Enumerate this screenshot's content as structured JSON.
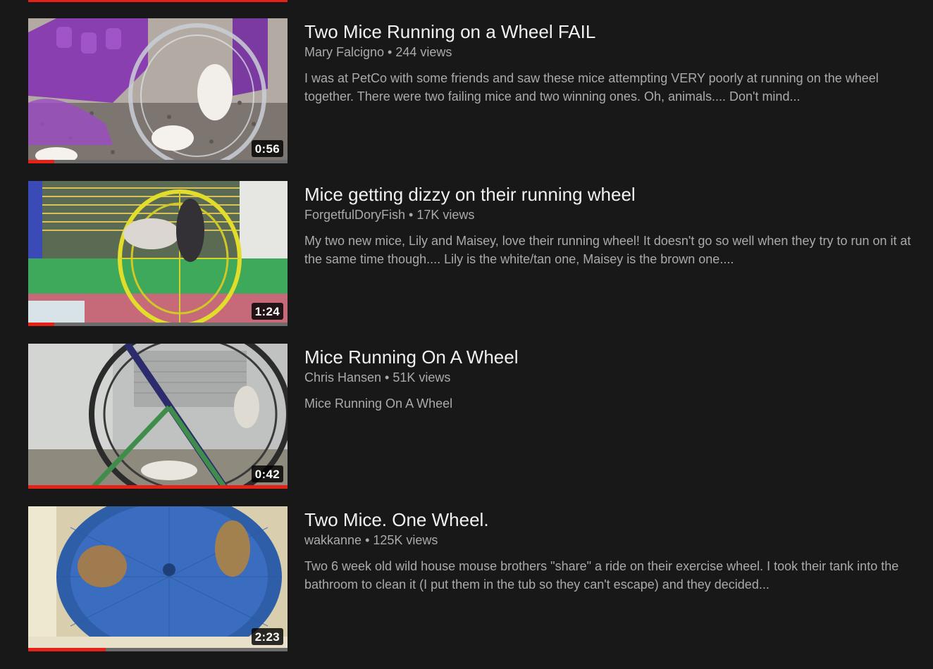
{
  "videos": [
    {
      "title": "Two Mice Running on a Wheel FAIL",
      "channel": "Mary Falcigno",
      "views": "244 views",
      "description": "I was at PetCo with some friends and saw these mice attempting VERY poorly at running on the wheel together. There were two failing mice and two winning ones. Oh, animals.... Don't mind...",
      "duration": "0:56",
      "watched_fraction": 0.1,
      "thumbnail_icon": "mice-plastic-wheel-thumbnail"
    },
    {
      "title": "Mice getting dizzy on their running wheel",
      "channel": "ForgetfulDoryFish",
      "views": "17K views",
      "description": "My two new mice, Lily and Maisey, love their running wheel! It doesn't go so well when they try to run on it at the same time though.... Lily is the white/tan one, Maisey is the brown one....",
      "duration": "1:24",
      "watched_fraction": 0.1,
      "thumbnail_icon": "mice-yellow-wheel-thumbnail"
    },
    {
      "title": "Mice Running On A Wheel",
      "channel": "Chris Hansen",
      "views": "51K views",
      "description": "Mice Running On A Wheel",
      "duration": "0:42",
      "watched_fraction": 1.0,
      "thumbnail_icon": "mice-black-wheel-thumbnail"
    },
    {
      "title": "Two Mice. One Wheel.",
      "channel": "wakkanne",
      "views": "125K views",
      "description": "Two 6 week old wild house mouse brothers \"share\" a ride on their exercise wheel. I took their tank into the bathroom to clean it (I put them in the tub so they can't escape) and they decided...",
      "duration": "2:23",
      "watched_fraction": 0.3,
      "thumbnail_icon": "mice-blue-wheel-thumbnail"
    }
  ],
  "colors": {
    "background": "#181818",
    "title": "#f1f1f1",
    "secondary_text": "#aaaaaa",
    "progress_red": "#e62117",
    "progress_track": "#6b6b6b"
  },
  "separator": "•"
}
